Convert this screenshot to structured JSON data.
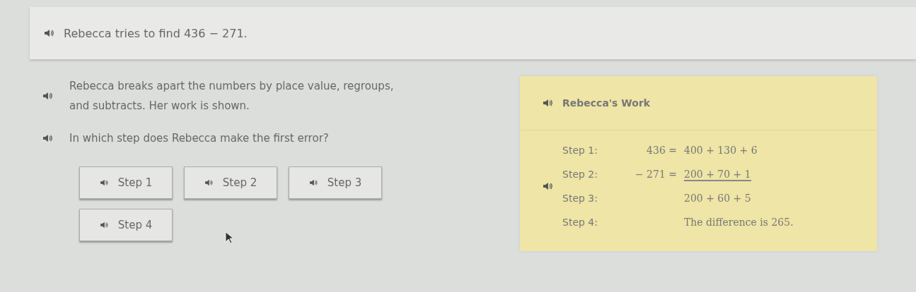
{
  "prompt": "Rebecca tries to find 436 − 271.",
  "description": "Rebecca breaks apart the numbers by place value, regroups, and subtracts. Her work is shown.",
  "question": "In which step does Rebecca make the first error?",
  "choices": [
    {
      "label": "Step 1",
      "selected": false
    },
    {
      "label": "Step 2",
      "selected": false
    },
    {
      "label": "Step 3",
      "selected": false
    },
    {
      "label": "Step 4",
      "selected": false
    }
  ],
  "work": {
    "title": "Rebecca's Work",
    "steps": [
      {
        "label": "Step 1:",
        "left": "436 =",
        "right": "400 + 130 + 6",
        "underlined": false
      },
      {
        "label": "Step 2:",
        "left": "− 271 =",
        "right": "200 + 70 + 1",
        "underlined": true
      },
      {
        "label": "Step 3:",
        "right": "200 + 60 + 5",
        "underlined": false
      },
      {
        "label": "Step 4:",
        "right": "The difference is 265.",
        "underlined": false
      }
    ]
  }
}
